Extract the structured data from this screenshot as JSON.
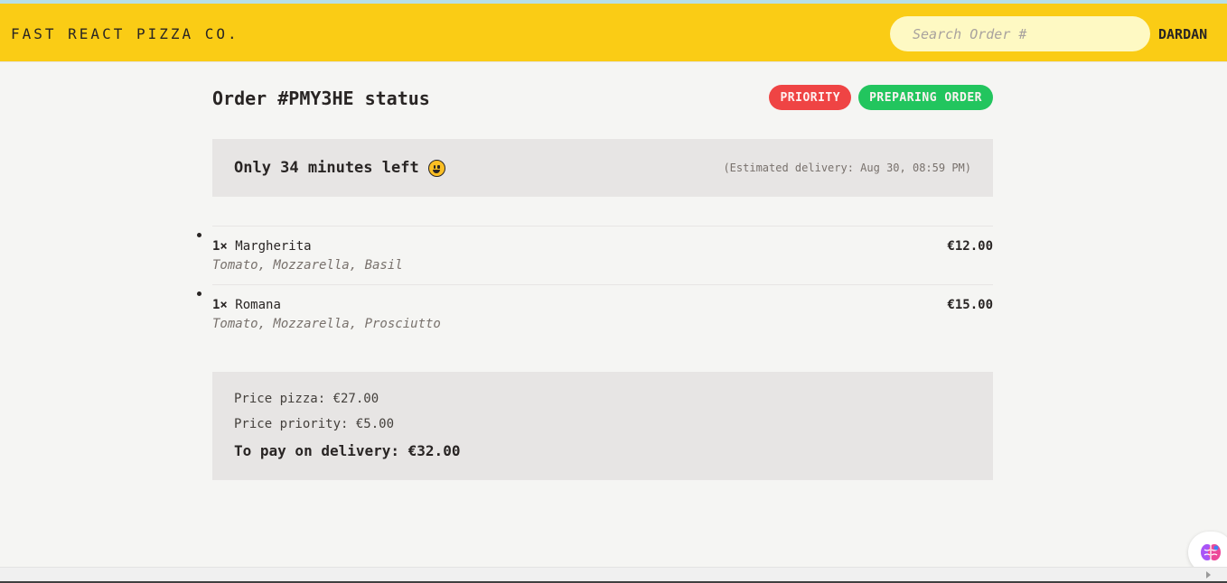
{
  "header": {
    "logo": "FAST REACT PIZZA CO.",
    "search_placeholder": "Search Order #",
    "username": "DARDAN"
  },
  "order": {
    "title": "Order #PMY3HE status",
    "badges": [
      "PRIORITY",
      "PREPARING ORDER"
    ],
    "eta_text": "Only 34 minutes left",
    "eta_icon": "smiley-emoji-icon",
    "estimated_delivery": "(Estimated delivery: Aug 30, 08:59 PM)"
  },
  "items": [
    {
      "qty": "1×",
      "name": "Margherita",
      "ingredients": "Tomato, Mozzarella, Basil",
      "price": "€12.00"
    },
    {
      "qty": "1×",
      "name": "Romana",
      "ingredients": "Tomato, Mozzarella, Prosciutto",
      "price": "€15.00"
    }
  ],
  "summary": {
    "price_pizza": "Price pizza: €27.00",
    "price_priority": "Price priority: €5.00",
    "total": "To pay on delivery: €32.00"
  },
  "colors": {
    "header_bg": "#facc15",
    "priority_badge": "#ef4444",
    "status_badge": "#22c55e",
    "box_bg": "#e7e5e4"
  },
  "icons": {
    "helper": "brain-icon"
  }
}
